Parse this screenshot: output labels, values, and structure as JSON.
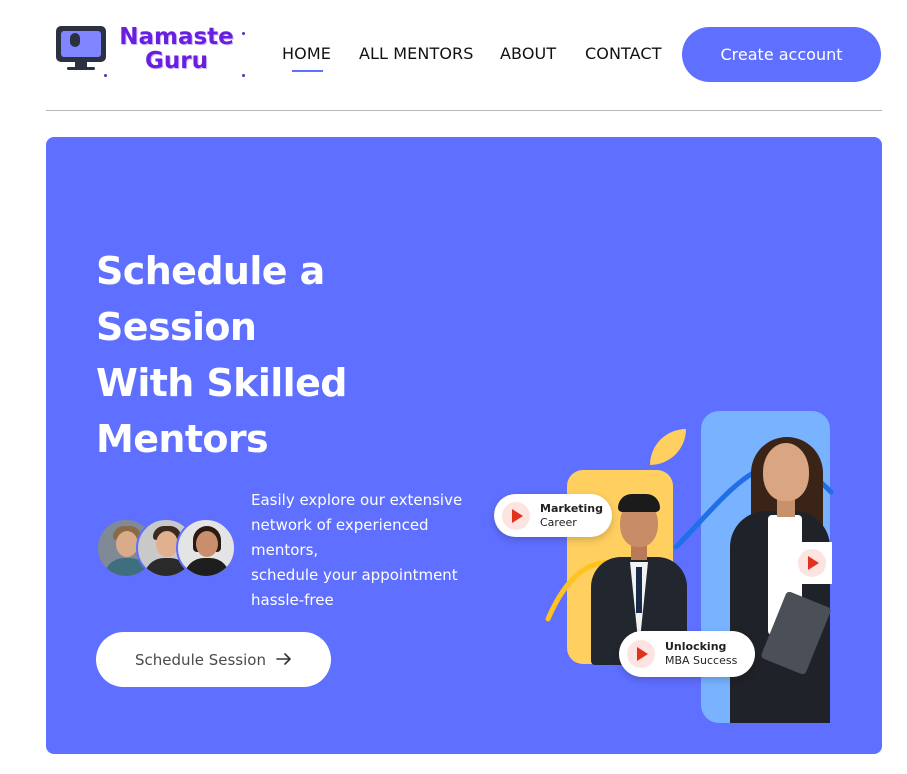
{
  "brand": {
    "line1": "Namaste",
    "line2": "Guru",
    "logo_icon": "monitor-mic-icon"
  },
  "nav": {
    "items": [
      {
        "label": "HOME",
        "active": true
      },
      {
        "label": "ALL MENTORS",
        "active": false
      },
      {
        "label": "ABOUT",
        "active": false
      },
      {
        "label": "CONTACT",
        "active": false
      }
    ],
    "cta_label": "Create account"
  },
  "hero": {
    "title_lines": [
      "Schedule a",
      "Session",
      "With Skilled",
      "Mentors"
    ],
    "description_lines": [
      "Easily explore our extensive",
      "network of experienced",
      "mentors,",
      "schedule your appointment",
      "hassle-free"
    ],
    "button_label": "Schedule Session",
    "button_icon": "arrow-right-icon",
    "pills": [
      {
        "title": "Marketing",
        "subtitle": "Career"
      },
      {
        "title": "Unlocking",
        "subtitle": "MBA Success"
      }
    ]
  },
  "colors": {
    "primary": "#5f6fff",
    "accent_yellow": "#ffcf5f",
    "accent_blue": "#79b3ff",
    "play_red": "#e0321c"
  }
}
